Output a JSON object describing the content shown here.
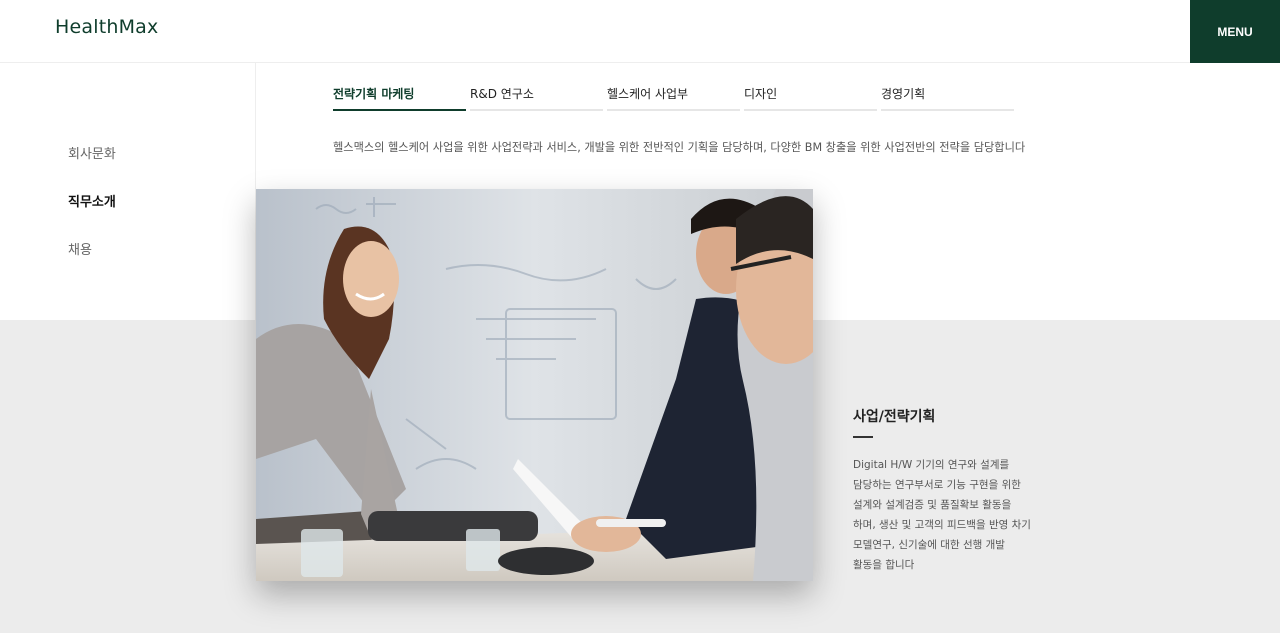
{
  "header": {
    "logo": "HealthMax",
    "menu_label": "MENU"
  },
  "sidebar": {
    "items": [
      {
        "label": "회사문화"
      },
      {
        "label": "직무소개"
      },
      {
        "label": "채용"
      }
    ],
    "active_index": 1
  },
  "tabs": [
    {
      "label": "전략기획 마케팅"
    },
    {
      "label": "R&D 연구소"
    },
    {
      "label": "헬스케어 사업부"
    },
    {
      "label": "디자인"
    },
    {
      "label": "경영기획"
    }
  ],
  "active_tab": 0,
  "description": "헬스맥스의 헬스케어 사업을 위한 사업전략과 서비스, 개발을 위한 전반적인 기획을 담당하며, 다양한 BM 창출을 위한 사업전반의 전략을 담당합니다",
  "detail": {
    "title": "사업/전략기획",
    "lines": [
      "Digital H/W 기기의 연구와 설계를",
      "담당하는 연구부서로 기능 구현을 위한",
      "설계와 설계검증 및 품질확보 활동을",
      "하며, 생산 및 고객의 피드백을 반영 차기",
      "모델연구, 신기술에 대한 선행 개발",
      "활동을 합니다"
    ]
  },
  "colors": {
    "brand": "#0f3d2c",
    "band": "#ececec"
  }
}
